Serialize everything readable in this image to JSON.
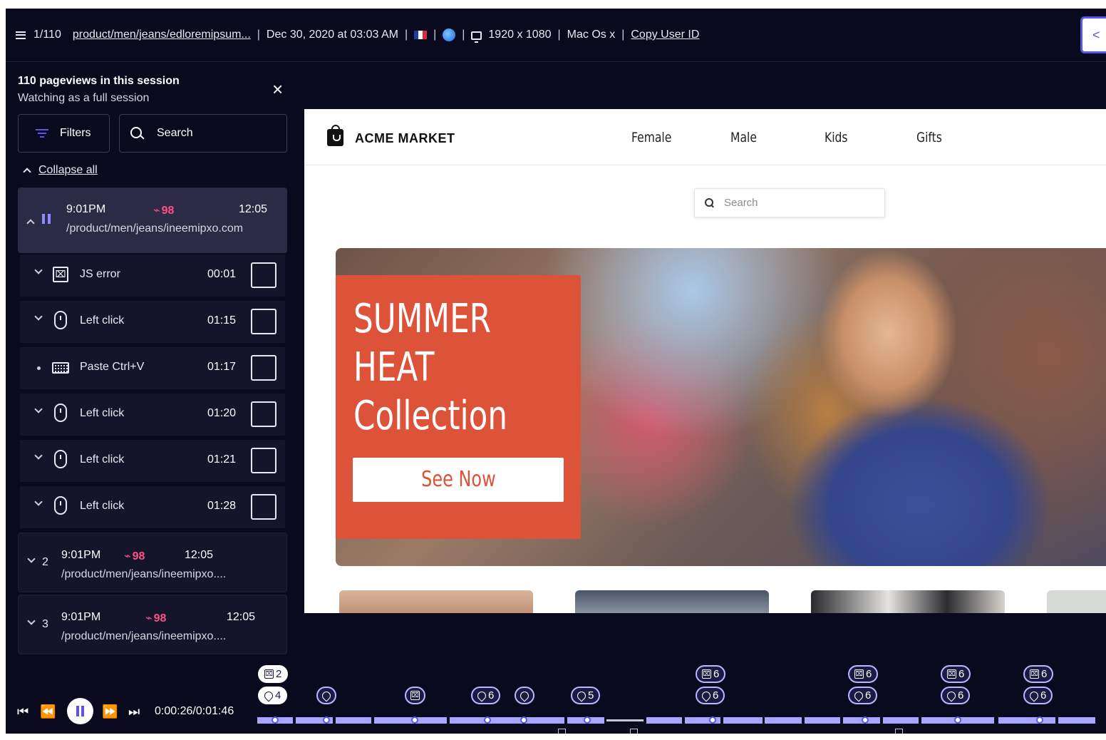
{
  "topbar": {
    "page_count": "1/110",
    "url": "product/men/jeans/edloremipsum...",
    "date": "Dec 30, 2020 at 03:03 AM",
    "flag_colors": [
      "#1e3ea8",
      "#ffffff",
      "#e0283a"
    ],
    "browser_icon": "safari-icon",
    "resolution": "1920 x 1080",
    "os": "Mac Os x",
    "copy_user": "Copy User ID",
    "share_icon": "share-icon"
  },
  "sidebar": {
    "title": "110 pageviews in this session",
    "subtitle": "Watching as a full session",
    "filters_label": "Filters",
    "search_label": "Search",
    "collapse_label": "Collapse all",
    "active_page": {
      "time": "9:01PM",
      "score": "98",
      "duration": "12:05",
      "url": "/product/men/jeans/ineemipxo.com"
    },
    "events": [
      {
        "icon": "js-error-icon",
        "label": "JS error",
        "time": "00:01"
      },
      {
        "icon": "mouse-icon",
        "label": "Left click",
        "time": "01:15"
      },
      {
        "icon": "keyboard-icon",
        "label": "Paste Ctrl+V",
        "time": "01:17"
      },
      {
        "icon": "mouse-icon",
        "label": "Left click",
        "time": "01:20"
      },
      {
        "icon": "mouse-icon",
        "label": "Left click",
        "time": "01:21"
      },
      {
        "icon": "mouse-icon",
        "label": "Left click",
        "time": "01:28"
      }
    ],
    "pages": [
      {
        "num": "2",
        "time": "9:01PM",
        "score": "98",
        "duration": "12:05",
        "url": "/product/men/jeans/ineemipxo...."
      },
      {
        "num": "3",
        "time": "9:01PM",
        "score": "98",
        "duration": "12:05",
        "url": "/product/men/jeans/ineemipxo...."
      }
    ]
  },
  "site": {
    "brand": "ACME MARKET",
    "nav": [
      "Female",
      "Male",
      "Kids",
      "Gifts"
    ],
    "search_placeholder": "Search",
    "hero_line1": "SUMMER",
    "hero_line2": "HEAT",
    "hero_line3": "Collection",
    "hero_button": "See Now",
    "accent": "#dd533a"
  },
  "player": {
    "time": "0:00:26/0:01:46",
    "accent": "#5a57e6",
    "badges": [
      {
        "type": "error",
        "label": "2",
        "white": true
      },
      {
        "type": "click",
        "label": "4",
        "white": true
      },
      {
        "type": "click",
        "label": ""
      },
      {
        "type": "error",
        "label": ""
      },
      {
        "type": "click",
        "label": "6"
      },
      {
        "type": "click",
        "label": ""
      },
      {
        "type": "click",
        "label": "5"
      },
      {
        "type": "error",
        "label": "6"
      },
      {
        "type": "click",
        "label": "6"
      },
      {
        "type": "error",
        "label": "6"
      },
      {
        "type": "click",
        "label": "6"
      },
      {
        "type": "error",
        "label": "6"
      },
      {
        "type": "click",
        "label": "6"
      },
      {
        "type": "error",
        "label": "6"
      },
      {
        "type": "click",
        "label": "6"
      }
    ]
  }
}
